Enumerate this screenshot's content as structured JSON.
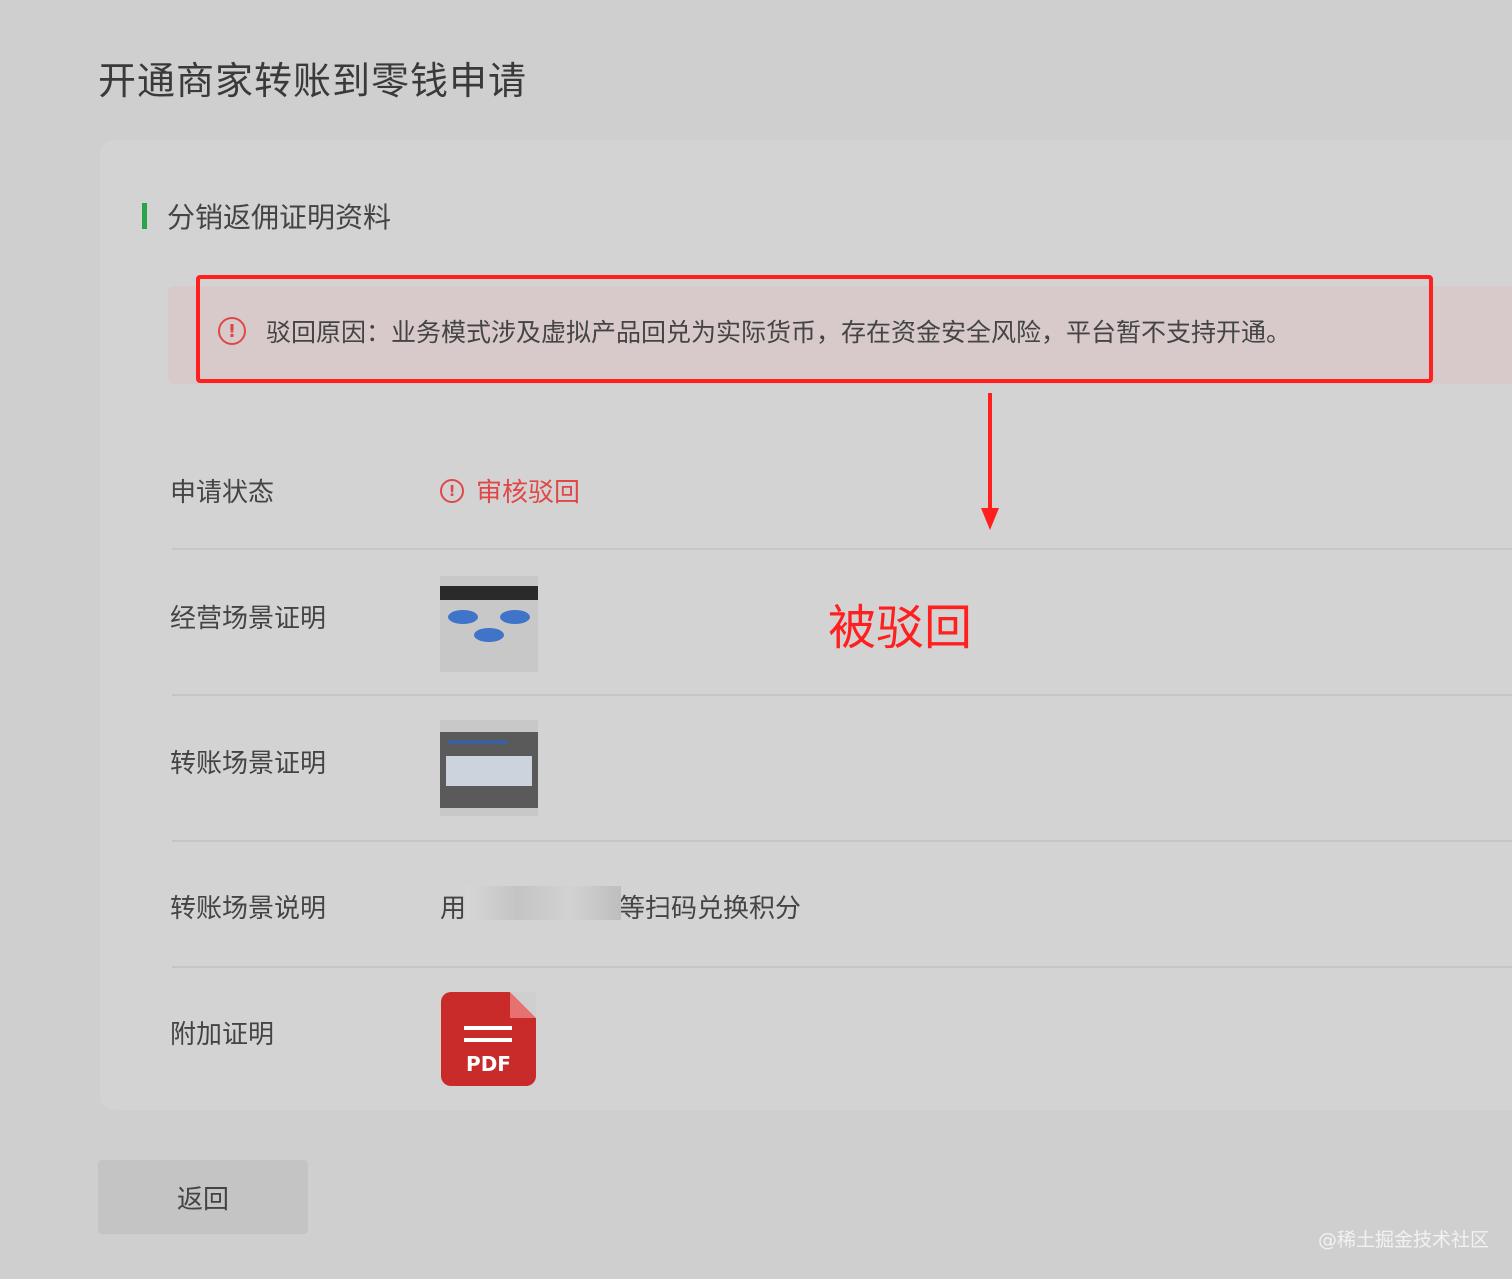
{
  "page": {
    "title": "开通商家转账到零钱申请"
  },
  "section": {
    "title": "分销返佣证明资料"
  },
  "reject_banner": {
    "text": "驳回原因：业务模式涉及虚拟产品回兑为实际货币，存在资金安全风险，平台暂不支持开通。"
  },
  "annotation": {
    "label": "被驳回",
    "color": "#ff1f1f"
  },
  "rows": [
    {
      "label": "申请状态",
      "value": "审核驳回",
      "value_color": "#e04848"
    },
    {
      "label": "经营场景证明"
    },
    {
      "label": "转账场景证明"
    },
    {
      "label": "转账场景说明",
      "value_visible_start": "用",
      "value_visible_end": "等扫码兑换积分"
    },
    {
      "label": "附加证明",
      "file_type": "PDF"
    }
  ],
  "footer": {
    "back_label": "返回",
    "watermark": "@稀土掘金技术社区"
  },
  "colors": {
    "accent_green": "#2ba24c",
    "error_red": "#e04848"
  }
}
